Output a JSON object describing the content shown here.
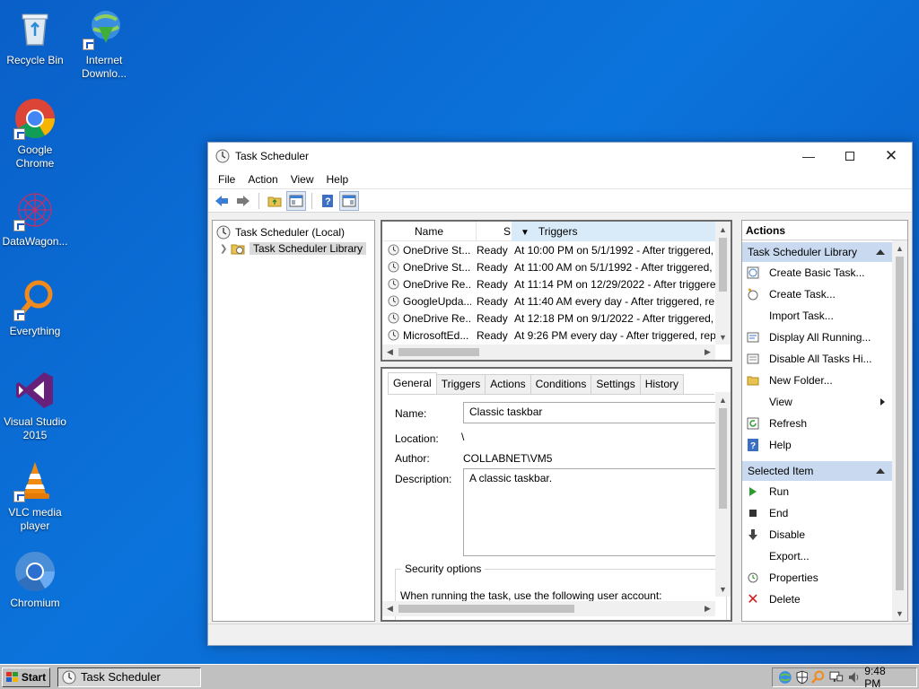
{
  "desktop": {
    "icons": [
      {
        "label": "Recycle Bin",
        "icon": "recycle-bin-icon"
      },
      {
        "label": "Internet Downlo...",
        "icon": "internet-download-manager-icon"
      },
      {
        "label": "Google Chrome",
        "icon": "chrome-icon"
      },
      {
        "label": "DataWagon...",
        "icon": "datawagon-icon"
      },
      {
        "label": "Everything",
        "icon": "everything-search-icon"
      },
      {
        "label": "Visual Studio 2015",
        "icon": "visual-studio-icon"
      },
      {
        "label": "VLC media player",
        "icon": "vlc-icon"
      },
      {
        "label": "Chromium",
        "icon": "chromium-icon"
      }
    ]
  },
  "window": {
    "title": "Task Scheduler",
    "menu": [
      "File",
      "Action",
      "View",
      "Help"
    ],
    "tree": {
      "root": "Task Scheduler (Local)",
      "library": "Task Scheduler Library"
    },
    "task_list": {
      "columns": {
        "name": "Name",
        "status": "S",
        "triggers": "Triggers"
      },
      "rows": [
        {
          "name": "OneDrive St...",
          "status": "Ready",
          "trigger": "At 10:00 PM on 5/1/1992 - After triggered,"
        },
        {
          "name": "OneDrive St...",
          "status": "Ready",
          "trigger": "At 11:00 AM on 5/1/1992 - After triggered,"
        },
        {
          "name": "OneDrive Re...",
          "status": "Ready",
          "trigger": "At 11:14 PM on 12/29/2022 - After triggere"
        },
        {
          "name": "GoogleUpda...",
          "status": "Ready",
          "trigger": "At 11:40 AM every day - After triggered, re"
        },
        {
          "name": "OneDrive Re...",
          "status": "Ready",
          "trigger": "At 12:18 PM on 9/1/2022 - After triggered,"
        },
        {
          "name": "MicrosoftEd...",
          "status": "Ready",
          "trigger": "At 9:26 PM every day - After triggered, rep"
        }
      ]
    },
    "details": {
      "tabs": [
        "General",
        "Triggers",
        "Actions",
        "Conditions",
        "Settings",
        "History"
      ],
      "active_tab": "General",
      "name_label": "Name:",
      "name_value": "Classic taskbar",
      "location_label": "Location:",
      "location_value": "\\",
      "author_label": "Author:",
      "author_value": "COLLABNET\\VM5",
      "description_label": "Description:",
      "description_value": "A classic taskbar.",
      "security_title": "Security options",
      "security_text": "When running the task, use the following user account:"
    },
    "actions_pane": {
      "header": "Actions",
      "library_section": "Task Scheduler Library",
      "library_items": [
        {
          "label": "Create Basic Task...",
          "icon": "create-basic-task-icon"
        },
        {
          "label": "Create Task...",
          "icon": "create-task-icon"
        },
        {
          "label": "Import Task...",
          "icon": ""
        },
        {
          "label": "Display All Running...",
          "icon": "display-running-icon"
        },
        {
          "label": "Disable All Tasks Hi...",
          "icon": "disable-history-icon"
        },
        {
          "label": "New Folder...",
          "icon": "folder-icon"
        },
        {
          "label": "View",
          "icon": ""
        },
        {
          "label": "Refresh",
          "icon": "refresh-icon"
        },
        {
          "label": "Help",
          "icon": "help-icon"
        }
      ],
      "selected_section": "Selected Item",
      "selected_items": [
        {
          "label": "Run",
          "icon": "run-icon"
        },
        {
          "label": "End",
          "icon": "end-icon"
        },
        {
          "label": "Disable",
          "icon": "disable-icon"
        },
        {
          "label": "Export...",
          "icon": ""
        },
        {
          "label": "Properties",
          "icon": "properties-icon"
        },
        {
          "label": "Delete",
          "icon": "delete-icon"
        }
      ]
    }
  },
  "taskbar": {
    "start_label": "Start",
    "task_label": "Task Scheduler",
    "clock": "9:48 PM"
  },
  "colors": {
    "desktop_blue": "#0b74dc",
    "section_header": "#c9daf0",
    "delete_red": "#d01818",
    "run_green": "#2e9b2e"
  }
}
